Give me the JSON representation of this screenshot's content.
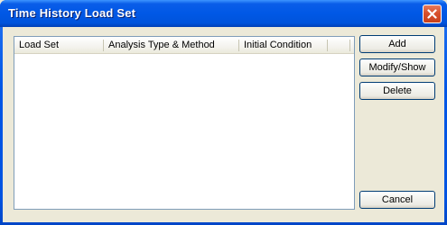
{
  "window": {
    "title": "Time History Load Set"
  },
  "list": {
    "columns": [
      "Load Set",
      "Analysis Type & Method",
      "Initial Condition",
      ""
    ],
    "rows": []
  },
  "buttons": {
    "add": "Add",
    "modify": "Modify/Show",
    "delete": "Delete",
    "cancel": "Cancel"
  },
  "icons": {
    "close": "close-icon"
  },
  "colors": {
    "titlebar": "#0058e6",
    "dialog_bg": "#ece9d8",
    "close_button": "#d8502b"
  }
}
